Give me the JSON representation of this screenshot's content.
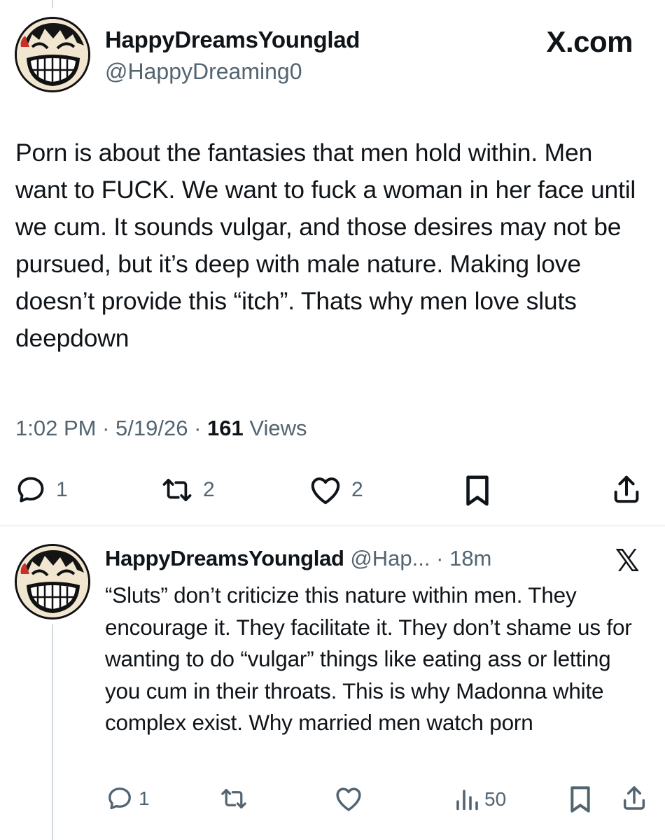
{
  "main_tweet": {
    "display_name": "HappyDreamsYounglad",
    "handle": "@HappyDreaming0",
    "brand": "X.com",
    "text": "Porn is about the fantasies that men hold within. Men want to FUCK. We want to fuck a woman in her face until we cum. It sounds vulgar, and those desires may not be pursued, but it’s deep with male nature. Making love doesn’t provide this “itch”. Thats why men love sluts deepdown",
    "time": "1:02 PM",
    "date": "5/19/26",
    "views_count": "161",
    "views_label": "Views",
    "actions": {
      "reply_count": "1",
      "repost_count": "2",
      "like_count": "2"
    }
  },
  "reply_tweet": {
    "display_name": "HappyDreamsYounglad",
    "handle_truncated": "@Hap...",
    "age": "18m",
    "text": "“Sluts” don’t criticize this nature within men. They encourage it. They facilitate it. They don’t shame us for wanting to do “vulgar” things like eating ass or letting you cum in their throats. This is why Madonna white complex exist. Why married men watch porn",
    "actions": {
      "reply_count": "1",
      "views_count": "50"
    }
  },
  "icons": [
    "avatar",
    "reply-icon",
    "repost-icon",
    "like-icon",
    "bookmark-icon",
    "share-icon",
    "views-icon",
    "x-logo-icon"
  ],
  "colors": {
    "text": "#0f1419",
    "secondary": "#536471",
    "divider": "#eff3f4",
    "thread_line": "#cfd9de"
  }
}
